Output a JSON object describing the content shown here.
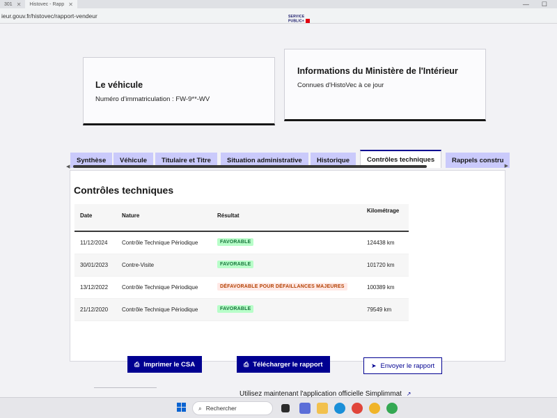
{
  "browser": {
    "tabs": [
      {
        "label": "301"
      },
      {
        "label": "Histovec - Rapp"
      }
    ],
    "url": "ieur.gouv.fr/histovec/rapport-vendeur"
  },
  "brand": {
    "line1": "SERVICE",
    "line2": "PUBLIC+"
  },
  "vehicle_card": {
    "title": "Le véhicule",
    "registration": "Numéro d'immatriculation : FW-9**-WV"
  },
  "ministry_card": {
    "title": "Informations du Ministère de l'Intérieur",
    "subtitle": "Connues d'HistoVec à ce jour"
  },
  "tabs": [
    {
      "label": "Synthèse",
      "active": false
    },
    {
      "label": "Véhicule",
      "active": false
    },
    {
      "label": "Titulaire et Titre",
      "active": false
    },
    {
      "label": "Situation administrative",
      "active": false
    },
    {
      "label": "Historique",
      "active": false
    },
    {
      "label": "Contrôles techniques",
      "active": true
    },
    {
      "label": "Rappels constru",
      "active": false
    }
  ],
  "controls": {
    "title": "Contrôles techniques",
    "headers": {
      "date": "Date",
      "nature": "Nature",
      "result": "Résultat",
      "km": "Kilométrage"
    },
    "rows": [
      {
        "date": "11/12/2024",
        "nature": "Contrôle Technique Périodique",
        "result": "FAVORABLE",
        "status": "ok",
        "km": "124438 km"
      },
      {
        "date": "30/01/2023",
        "nature": "Contre-Visite",
        "result": "FAVORABLE",
        "status": "ok",
        "km": "101720 km"
      },
      {
        "date": "13/12/2022",
        "nature": "Contrôle Technique Périodique",
        "result": "DÉFAVORABLE POUR DÉFAILLANCES MAJEURES",
        "status": "ko",
        "km": "100389 km"
      },
      {
        "date": "21/12/2020",
        "nature": "Contrôle Technique Périodique",
        "result": "FAVORABLE",
        "status": "ok",
        "km": "79549 km"
      }
    ]
  },
  "actions": {
    "print_label": "Imprimer le CSA",
    "download_label": "Télécharger le rapport",
    "send_label": "Envoyer le rapport"
  },
  "footer": {
    "simplimmat": "Utilisez maintenant l'application officielle Simplimmat"
  },
  "taskbar": {
    "search_placeholder": "Rechercher"
  },
  "colors": {
    "primary": "#000091",
    "tab_bg": "#cacafb",
    "favorable_bg": "#b8fec9",
    "favorable_fg": "#18753c",
    "defavorable_bg": "#ffe9e6",
    "defavorable_fg": "#b34000"
  }
}
